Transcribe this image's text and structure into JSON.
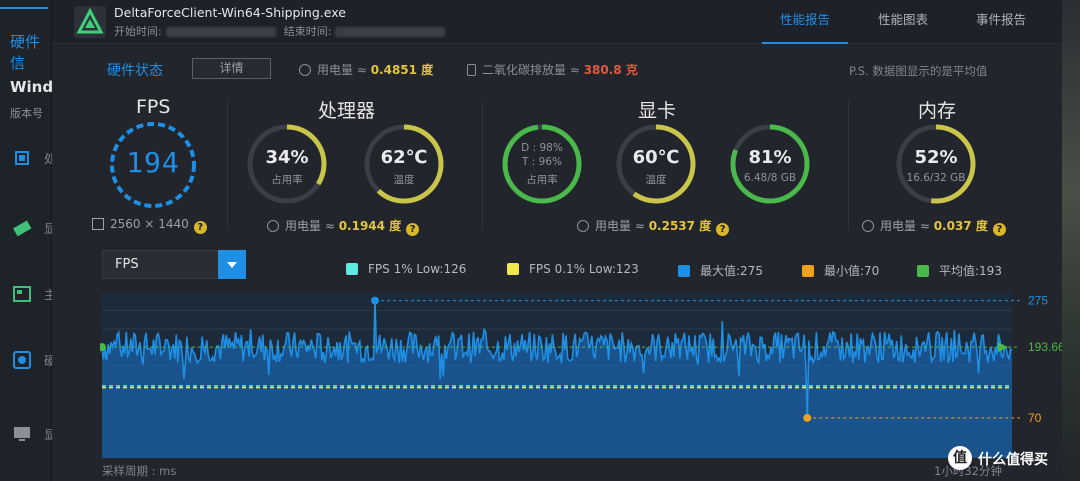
{
  "left_sidebar": {
    "title": "硬件信",
    "os_title": "Wind",
    "version_label": "版本号",
    "items": [
      {
        "icon": "cpu-icon",
        "label": "处"
      },
      {
        "icon": "gpu-icon",
        "label": "显"
      },
      {
        "icon": "board-icon",
        "label": "主"
      },
      {
        "icon": "disk-icon",
        "label": "硬"
      },
      {
        "icon": "monitor-icon",
        "label": "显"
      }
    ]
  },
  "window": {
    "app_name": "DeltaForceClient-Win64-Shipping.exe",
    "start_label": "开始时间:",
    "end_label": "结束时间:",
    "tabs": [
      {
        "label": "性能报告",
        "active": true
      },
      {
        "label": "性能图表",
        "active": false
      },
      {
        "label": "事件报告",
        "active": false
      }
    ]
  },
  "hardware": {
    "label": "硬件状态",
    "detail_button": "详情",
    "power_label": "用电量 ≈",
    "power_value": "0.4851 度",
    "co2_label": "二氧化碳排放量 ≈",
    "co2_value": "380.8 克",
    "note": "P.S. 数据图显示的是平均值"
  },
  "fps": {
    "title": "FPS",
    "value": "194",
    "resolution": "2560 × 1440"
  },
  "cpu": {
    "title": "处理器",
    "usage": "34%",
    "usage_label": "占用率",
    "usage_fraction": 0.34,
    "temp": "62℃",
    "temp_label": "温度",
    "temp_fraction": 0.62,
    "power_label": "用电量 ≈",
    "power_value": "0.1944 度"
  },
  "gpu": {
    "title": "显卡",
    "usage_d": "D : 98%",
    "usage_t": "T : 96%",
    "usage_label": "占用率",
    "usage_fraction": 0.98,
    "temp": "60℃",
    "temp_label": "温度",
    "temp_fraction": 0.6,
    "mem": "81%",
    "mem_label": "6.48/8 GB",
    "mem_fraction": 0.81,
    "power_label": "用电量 ≈",
    "power_value": "0.2537 度"
  },
  "memory": {
    "title": "内存",
    "usage": "52%",
    "usage_label": "16.6/32 GB",
    "usage_fraction": 0.52,
    "power_label": "用电量 ≈",
    "power_value": "0.037 度"
  },
  "selector": {
    "value": "FPS"
  },
  "legend": [
    {
      "label": "FPS 1% Low:126",
      "color": "#5de8e0"
    },
    {
      "label": "FPS 0.1% Low:123",
      "color": "#f0e84a"
    },
    {
      "label": "最大值:275",
      "color": "#1f8fe6"
    },
    {
      "label": "最小值:70",
      "color": "#f0a020"
    },
    {
      "label": "平均值:193",
      "color": "#4ab84a"
    }
  ],
  "chart_data": {
    "type": "area",
    "series": [
      {
        "name": "FPS",
        "color": "#1f8fe6"
      }
    ],
    "max": 275,
    "min": 70,
    "avg": 193.66,
    "low1": 126,
    "low01": 123,
    "ylim": [
      0,
      290
    ],
    "annotations": [
      "275",
      "193.66",
      "70"
    ]
  },
  "footer": {
    "left": "采样周期 : ms",
    "right": "1小时32分钟"
  },
  "watermark": {
    "icon": "值",
    "text": "什么值得买"
  }
}
